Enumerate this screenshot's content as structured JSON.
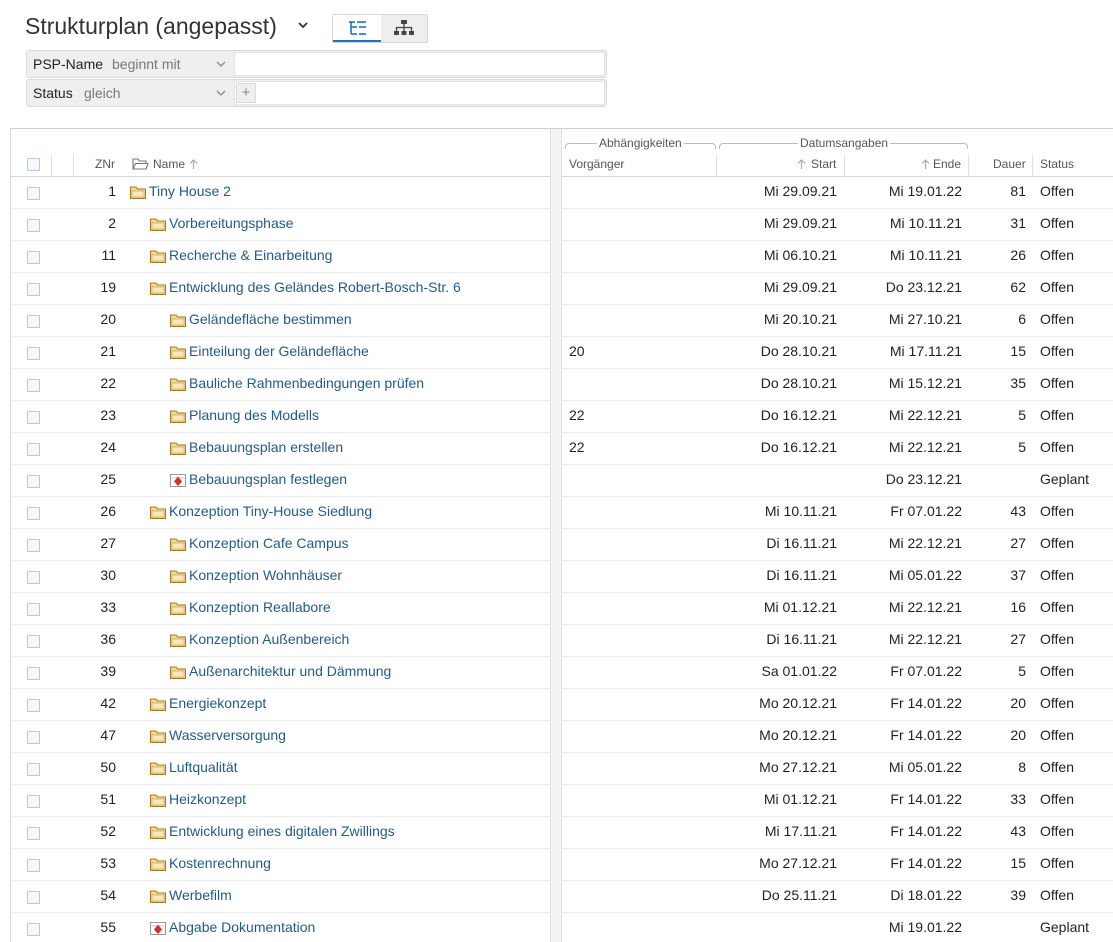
{
  "header": {
    "title": "Strukturplan (angepasst)",
    "view_modes": [
      {
        "icon": "tree-list-icon",
        "active": true
      },
      {
        "icon": "org-chart-icon",
        "active": false
      }
    ]
  },
  "filters": [
    {
      "field": "PSP-Name",
      "operator": "beginnt mit",
      "value": ""
    },
    {
      "field": "Status",
      "operator": "gleich",
      "value": "",
      "add_label": "+"
    }
  ],
  "columns": {
    "znr": "ZNr",
    "name": "Name",
    "group_deps": "Abhängigkeiten",
    "group_dates": "Datumsangaben",
    "vorgaenger": "Vorgänger",
    "start": "Start",
    "ende": "Ende",
    "dauer": "Dauer",
    "status": "Status"
  },
  "colors": {
    "link": "#1f5a8f",
    "accent": "#1a73c9",
    "folder": "#e9b75a",
    "milestone": "#e02b2b"
  },
  "rows": [
    {
      "znr": "1",
      "name": "Tiny House 2",
      "level": 0,
      "expander": "none",
      "icon": "folder-icon",
      "vorgaenger": "",
      "start": "Mi 29.09.21",
      "ende": "Mi 19.01.22",
      "dauer": "81",
      "status": "Offen"
    },
    {
      "znr": "2",
      "name": "Vorbereitungsphase",
      "level": 1,
      "expander": "collapsed",
      "icon": "folder-icon",
      "vorgaenger": "",
      "start": "Mi 29.09.21",
      "ende": "Mi 10.11.21",
      "dauer": "31",
      "status": "Offen"
    },
    {
      "znr": "11",
      "name": "Recherche & Einarbeitung",
      "level": 1,
      "expander": "collapsed",
      "icon": "folder-icon",
      "vorgaenger": "",
      "start": "Mi 06.10.21",
      "ende": "Mi 10.11.21",
      "dauer": "26",
      "status": "Offen"
    },
    {
      "znr": "19",
      "name": "Entwicklung des Geländes Robert-Bosch-Str. 6",
      "level": 1,
      "expander": "expanded",
      "icon": "folder-icon",
      "vorgaenger": "",
      "start": "Mi 29.09.21",
      "ende": "Do 23.12.21",
      "dauer": "62",
      "status": "Offen"
    },
    {
      "znr": "20",
      "name": "Geländefläche bestimmen",
      "level": 2,
      "expander": "none",
      "icon": "folder-icon",
      "vorgaenger": "",
      "start": "Mi 20.10.21",
      "ende": "Mi 27.10.21",
      "dauer": "6",
      "status": "Offen"
    },
    {
      "znr": "21",
      "name": "Einteilung der Geländefläche",
      "level": 2,
      "expander": "none",
      "icon": "folder-icon",
      "vorgaenger": "20",
      "start": "Do 28.10.21",
      "ende": "Mi 17.11.21",
      "dauer": "15",
      "status": "Offen"
    },
    {
      "znr": "22",
      "name": "Bauliche Rahmenbedingungen prüfen",
      "level": 2,
      "expander": "none",
      "icon": "folder-icon",
      "vorgaenger": "",
      "start": "Do 28.10.21",
      "ende": "Mi 15.12.21",
      "dauer": "35",
      "status": "Offen"
    },
    {
      "znr": "23",
      "name": "Planung des Modells",
      "level": 2,
      "expander": "none",
      "icon": "folder-icon",
      "vorgaenger": "22",
      "start": "Do 16.12.21",
      "ende": "Mi 22.12.21",
      "dauer": "5",
      "status": "Offen"
    },
    {
      "znr": "24",
      "name": "Bebauungsplan erstellen",
      "level": 2,
      "expander": "none",
      "icon": "folder-icon",
      "vorgaenger": "22",
      "start": "Do 16.12.21",
      "ende": "Mi 22.12.21",
      "dauer": "5",
      "status": "Offen"
    },
    {
      "znr": "25",
      "name": "Bebauungsplan festlegen",
      "level": 2,
      "expander": "none",
      "icon": "milestone-icon",
      "vorgaenger": "",
      "start": "",
      "ende": "Do 23.12.21",
      "dauer": "",
      "status": "Geplant"
    },
    {
      "znr": "26",
      "name": "Konzeption Tiny-House Siedlung",
      "level": 1,
      "expander": "expanded",
      "icon": "folder-icon",
      "vorgaenger": "",
      "start": "Mi 10.11.21",
      "ende": "Fr 07.01.22",
      "dauer": "43",
      "status": "Offen"
    },
    {
      "znr": "27",
      "name": "Konzeption Cafe Campus",
      "level": 2,
      "expander": "collapsed",
      "icon": "folder-icon",
      "vorgaenger": "",
      "start": "Di 16.11.21",
      "ende": "Mi 22.12.21",
      "dauer": "27",
      "status": "Offen"
    },
    {
      "znr": "30",
      "name": "Konzeption Wohnhäuser",
      "level": 2,
      "expander": "collapsed",
      "icon": "folder-icon",
      "vorgaenger": "",
      "start": "Di 16.11.21",
      "ende": "Mi 05.01.22",
      "dauer": "37",
      "status": "Offen"
    },
    {
      "znr": "33",
      "name": "Konzeption Reallabore",
      "level": 2,
      "expander": "collapsed",
      "icon": "folder-icon",
      "vorgaenger": "",
      "start": "Mi 01.12.21",
      "ende": "Mi 22.12.21",
      "dauer": "16",
      "status": "Offen"
    },
    {
      "znr": "36",
      "name": "Konzeption Außenbereich",
      "level": 2,
      "expander": "collapsed",
      "icon": "folder-icon",
      "vorgaenger": "",
      "start": "Di 16.11.21",
      "ende": "Mi 22.12.21",
      "dauer": "27",
      "status": "Offen"
    },
    {
      "znr": "39",
      "name": "Außenarchitektur und Dämmung",
      "level": 2,
      "expander": "collapsed",
      "icon": "folder-icon",
      "vorgaenger": "",
      "start": "Sa 01.01.22",
      "ende": "Fr 07.01.22",
      "dauer": "5",
      "status": "Offen"
    },
    {
      "znr": "42",
      "name": "Energiekonzept",
      "level": 1,
      "expander": "collapsed",
      "icon": "folder-icon",
      "vorgaenger": "",
      "start": "Mo 20.12.21",
      "ende": "Fr 14.01.22",
      "dauer": "20",
      "status": "Offen"
    },
    {
      "znr": "47",
      "name": "Wasserversorgung",
      "level": 1,
      "expander": "collapsed",
      "icon": "folder-icon",
      "vorgaenger": "",
      "start": "Mo 20.12.21",
      "ende": "Fr 14.01.22",
      "dauer": "20",
      "status": "Offen"
    },
    {
      "znr": "50",
      "name": "Luftqualität",
      "level": 1,
      "expander": "none",
      "icon": "folder-icon",
      "vorgaenger": "",
      "start": "Mo 27.12.21",
      "ende": "Mi 05.01.22",
      "dauer": "8",
      "status": "Offen"
    },
    {
      "znr": "51",
      "name": "Heizkonzept",
      "level": 1,
      "expander": "none",
      "icon": "folder-icon",
      "vorgaenger": "",
      "start": "Mi 01.12.21",
      "ende": "Fr 14.01.22",
      "dauer": "33",
      "status": "Offen"
    },
    {
      "znr": "52",
      "name": "Entwicklung eines digitalen Zwillings",
      "level": 1,
      "expander": "none",
      "icon": "folder-icon",
      "vorgaenger": "",
      "start": "Mi 17.11.21",
      "ende": "Fr 14.01.22",
      "dauer": "43",
      "status": "Offen"
    },
    {
      "znr": "53",
      "name": "Kostenrechnung",
      "level": 1,
      "expander": "none",
      "icon": "folder-icon",
      "vorgaenger": "",
      "start": "Mo 27.12.21",
      "ende": "Fr 14.01.22",
      "dauer": "15",
      "status": "Offen"
    },
    {
      "znr": "54",
      "name": "Werbefilm",
      "level": 1,
      "expander": "none",
      "icon": "folder-icon",
      "vorgaenger": "",
      "start": "Do 25.11.21",
      "ende": "Di 18.01.22",
      "dauer": "39",
      "status": "Offen"
    },
    {
      "znr": "55",
      "name": "Abgabe Dokumentation",
      "level": 1,
      "expander": "none",
      "icon": "milestone-icon",
      "vorgaenger": "",
      "start": "",
      "ende": "Mi 19.01.22",
      "dauer": "",
      "status": "Geplant"
    }
  ]
}
